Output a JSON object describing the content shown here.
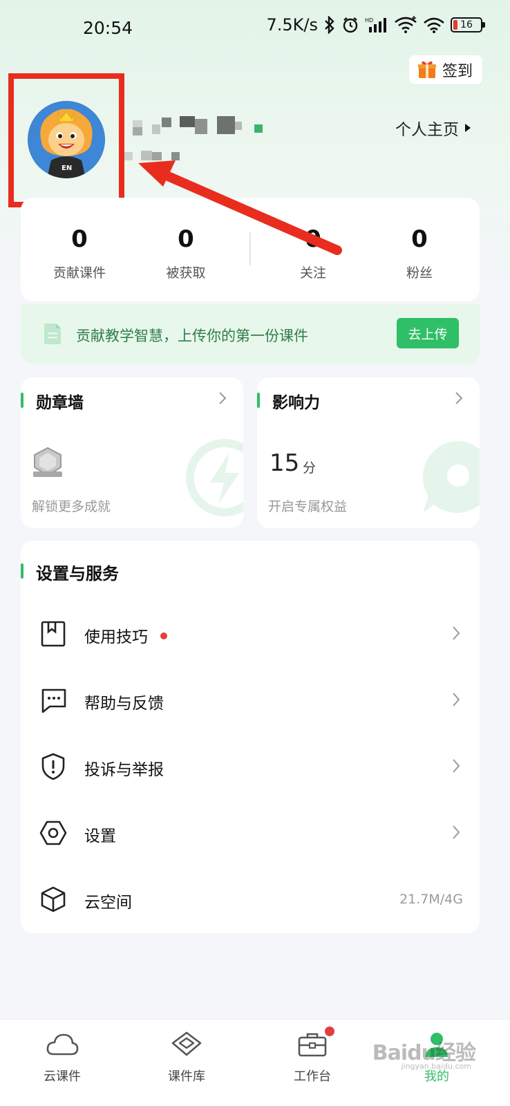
{
  "status_bar": {
    "time": "20:54",
    "network_speed": "7.5K/s",
    "battery_level": "16",
    "icons": [
      "bluetooth-icon",
      "alarm-icon",
      "signal-icon",
      "wifi-icon",
      "battery-icon"
    ]
  },
  "header": {
    "checkin_label": "签到",
    "profile_link_label": "个人主页"
  },
  "stats": [
    {
      "value": "0",
      "label": "贡献课件"
    },
    {
      "value": "0",
      "label": "被获取"
    },
    {
      "value": "0",
      "label": "关注"
    },
    {
      "value": "0",
      "label": "粉丝"
    }
  ],
  "banner": {
    "text": "贡献教学智慧，上传你的第一份课件",
    "button_label": "去上传"
  },
  "badge_card": {
    "title": "勋章墙",
    "subtitle": "解锁更多成就"
  },
  "influence_card": {
    "title": "影响力",
    "score": "15",
    "score_unit": "分",
    "subtitle": "开启专属权益"
  },
  "settings": {
    "title": "设置与服务",
    "items": [
      {
        "label": "使用技巧",
        "icon": "bookmark-icon",
        "badge": true
      },
      {
        "label": "帮助与反馈",
        "icon": "chat-icon"
      },
      {
        "label": "投诉与举报",
        "icon": "shield-alert-icon"
      },
      {
        "label": "设置",
        "icon": "hex-gear-icon"
      },
      {
        "label": "云空间",
        "icon": "cube-icon",
        "value": "21.7M/4G"
      }
    ]
  },
  "bottom_nav": [
    {
      "label": "云课件",
      "icon": "cloud-icon"
    },
    {
      "label": "课件库",
      "icon": "library-icon"
    },
    {
      "label": "工作台",
      "icon": "toolbox-icon"
    },
    {
      "label": "我的",
      "icon": "profile-icon",
      "active": true
    }
  ],
  "watermark": {
    "brand": "Baidu经验",
    "domain": "jingyan.baidu.com"
  },
  "colors": {
    "accent": "#2fbf66",
    "highlight_red": "#e82d1e",
    "notification_red": "#e53e3e"
  }
}
